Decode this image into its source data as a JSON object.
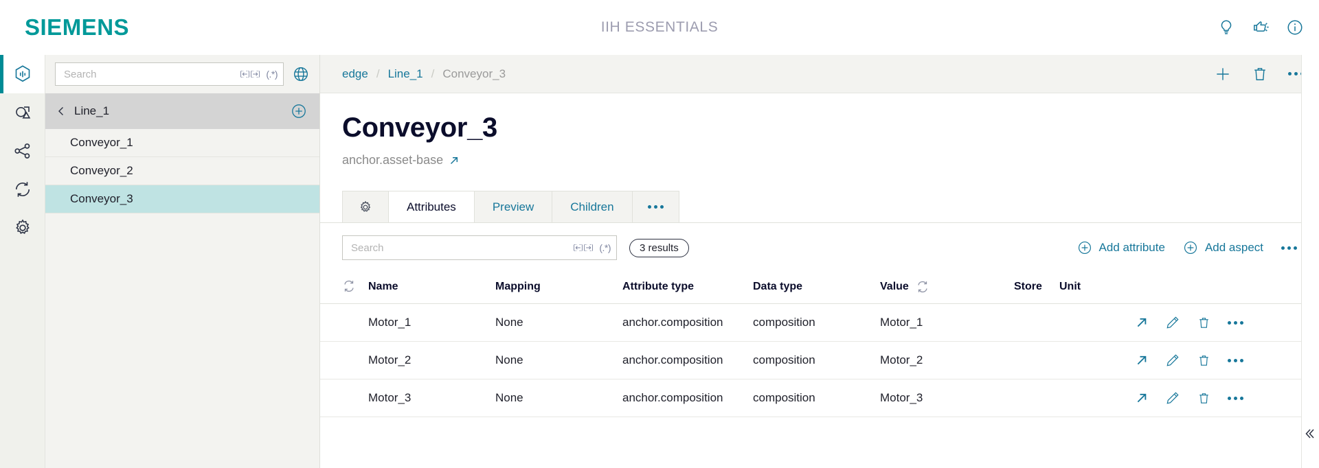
{
  "header": {
    "brand": "SIEMENS",
    "app_title": "IIH ESSENTIALS",
    "icons": [
      {
        "name": "lightbulb-icon",
        "label": "Tips"
      },
      {
        "name": "feedback-icon",
        "label": "Feedback"
      },
      {
        "name": "info-icon",
        "label": "Info"
      }
    ],
    "brand_color": "#009999",
    "accent_color": "#17779a"
  },
  "rail": {
    "items": [
      {
        "name": "assets-icon",
        "label": "Assets",
        "active": true
      },
      {
        "name": "aspects-icon",
        "label": "Aspects",
        "active": false
      },
      {
        "name": "connectivity-icon",
        "label": "Connectivity",
        "active": false
      },
      {
        "name": "sync-icon",
        "label": "Synchronization",
        "active": false
      },
      {
        "name": "settings-icon",
        "label": "Settings",
        "active": false
      }
    ]
  },
  "tree_panel": {
    "search": {
      "placeholder": "Search",
      "value": "",
      "whole_word_icon": "whole-word-icon",
      "regex_icon": "(.*)"
    },
    "globe_icon": "globe-icon",
    "header": {
      "label": "Line_1",
      "back_icon": "chevron-left-icon",
      "add_icon": "plus-circle-icon"
    },
    "items": [
      {
        "label": "Conveyor_1",
        "selected": false
      },
      {
        "label": "Conveyor_2",
        "selected": false
      },
      {
        "label": "Conveyor_3",
        "selected": true
      }
    ]
  },
  "breadcrumb": {
    "items": [
      {
        "label": "edge",
        "current": false
      },
      {
        "label": "Line_1",
        "current": false
      },
      {
        "label": "Conveyor_3",
        "current": true
      }
    ],
    "separator": "/",
    "actions": [
      {
        "name": "add-icon",
        "label": "Add"
      },
      {
        "name": "delete-icon",
        "label": "Delete"
      },
      {
        "name": "more-icon",
        "label": "More"
      }
    ]
  },
  "page": {
    "title": "Conveyor_3",
    "subtitle": "anchor.asset-base",
    "subtitle_link_icon": "external-link-icon"
  },
  "tabs": [
    {
      "label": "",
      "icon": "gear-icon",
      "active": false
    },
    {
      "label": "Attributes",
      "icon": "",
      "active": true
    },
    {
      "label": "Preview",
      "icon": "",
      "active": false
    },
    {
      "label": "Children",
      "icon": "",
      "active": false
    },
    {
      "label": "",
      "icon": "more-icon",
      "active": false
    }
  ],
  "toolbar": {
    "search": {
      "placeholder": "Search",
      "value": "",
      "whole_word_icon": "whole-word-icon",
      "regex_icon": "(.*)"
    },
    "results_badge": "3 results",
    "add_attribute_label": "Add attribute",
    "add_aspect_label": "Add aspect",
    "more_icon": "more-icon"
  },
  "table": {
    "columns": [
      {
        "key": "sort",
        "label": ""
      },
      {
        "key": "name",
        "label": "Name"
      },
      {
        "key": "mapping",
        "label": "Mapping"
      },
      {
        "key": "attribute_type",
        "label": "Attribute type"
      },
      {
        "key": "data_type",
        "label": "Data type"
      },
      {
        "key": "value",
        "label": "Value"
      },
      {
        "key": "store",
        "label": "Store"
      },
      {
        "key": "unit",
        "label": "Unit"
      },
      {
        "key": "actions",
        "label": ""
      }
    ],
    "rows": [
      {
        "name": "Motor_1",
        "mapping": "None",
        "attribute_type": "anchor.composition",
        "data_type": "composition",
        "value": "Motor_1",
        "store": "",
        "unit": ""
      },
      {
        "name": "Motor_2",
        "mapping": "None",
        "attribute_type": "anchor.composition",
        "data_type": "composition",
        "value": "Motor_2",
        "store": "",
        "unit": ""
      },
      {
        "name": "Motor_3",
        "mapping": "None",
        "attribute_type": "anchor.composition",
        "data_type": "composition",
        "value": "Motor_3",
        "store": "",
        "unit": ""
      }
    ],
    "row_actions": [
      {
        "name": "open-icon",
        "label": "Open"
      },
      {
        "name": "edit-icon",
        "label": "Edit"
      },
      {
        "name": "delete-icon",
        "label": "Delete"
      },
      {
        "name": "more-icon",
        "label": "More"
      }
    ]
  },
  "collapse_icon": "chevron-double-left-icon"
}
